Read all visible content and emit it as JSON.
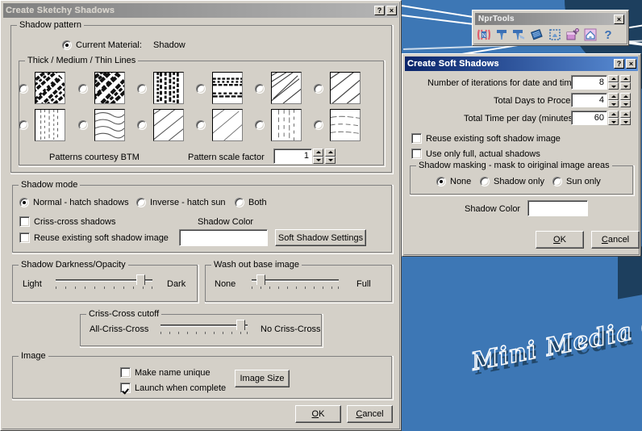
{
  "desktop": {
    "wallpaper_text": "Mini Media C",
    "bg_color": "#3d77b5",
    "accent_dark": "#1d3f5e"
  },
  "sketchy_dialog": {
    "title": "Create Sketchy Shadows",
    "title_state": "inactive",
    "help_button": "?",
    "close_button": "×",
    "shadow_pattern": {
      "group_label": "Shadow pattern",
      "current_material_label": "Current Material:",
      "current_material_value": "Shadow",
      "current_material_selected": true,
      "lines_group_label": "Thick / Medium / Thin Lines",
      "courtesy_label": "Patterns courtesy BTM",
      "scale_factor_label": "Pattern scale factor",
      "scale_factor_value": "1",
      "patterns": [
        {
          "id": "pattern-1",
          "selected": false,
          "kind": "thick-diagonal"
        },
        {
          "id": "pattern-2",
          "selected": false,
          "kind": "thick-diagonal-coarse"
        },
        {
          "id": "pattern-3",
          "selected": false,
          "kind": "thick-vertical"
        },
        {
          "id": "pattern-4",
          "selected": false,
          "kind": "thick-horizontal"
        },
        {
          "id": "pattern-5",
          "selected": false,
          "kind": "medium-diagonal"
        },
        {
          "id": "pattern-6",
          "selected": false,
          "kind": "medium-diagonal-2"
        },
        {
          "id": "pattern-7",
          "selected": false,
          "kind": "thin-vertical"
        },
        {
          "id": "pattern-8",
          "selected": false,
          "kind": "thin-wavy"
        },
        {
          "id": "pattern-9",
          "selected": false,
          "kind": "thin-diagonal"
        },
        {
          "id": "pattern-10",
          "selected": false,
          "kind": "thin-diagonal-sparse"
        },
        {
          "id": "pattern-11",
          "selected": false,
          "kind": "thin-vertical-sparse"
        },
        {
          "id": "pattern-12",
          "selected": false,
          "kind": "thin-horizontal"
        }
      ]
    },
    "shadow_mode": {
      "group_label": "Shadow mode",
      "modes": [
        {
          "label": "Normal - hatch shadows",
          "selected": true
        },
        {
          "label": "Inverse - hatch sun",
          "selected": false
        },
        {
          "label": "Both",
          "selected": false
        }
      ],
      "criss_cross_label": "Criss-cross shadows",
      "criss_cross_checked": false,
      "reuse_label": "Reuse existing soft shadow image",
      "reuse_checked": false,
      "shadow_color_label": "Shadow Color",
      "shadow_color_value": "#ffffff",
      "soft_shadow_settings_button": "Soft Shadow Settings"
    },
    "darkness": {
      "group_label": "Shadow Darkness/Opacity",
      "min_label": "Light",
      "max_label": "Dark",
      "value_pct": 88,
      "ticks": 11
    },
    "washout": {
      "group_label": "Wash out base image",
      "min_label": "None",
      "max_label": "Full",
      "value_pct": 6,
      "ticks": 11
    },
    "crisscross_cutoff": {
      "group_label": "Criss-Cross cutoff",
      "min_label": "All-Criss-Cross",
      "max_label": "No Criss-Cross",
      "value_pct": 92,
      "ticks": 11
    },
    "image": {
      "group_label": "Image",
      "make_unique_label": "Make name unique",
      "make_unique_checked": false,
      "launch_label": "Launch when complete",
      "launch_checked": true,
      "image_size_button": "Image Size"
    },
    "ok_button": "OK",
    "cancel_button": "Cancel"
  },
  "soft_dialog": {
    "title": "Create Soft Shadows",
    "title_state": "active",
    "help_button": "?",
    "close_button": "×",
    "fields": [
      {
        "label": "Number of iterations for date and time",
        "value": "8"
      },
      {
        "label": "Total Days to Process",
        "value": "4"
      },
      {
        "label": "Total Time per day (minutes)",
        "value": "60"
      }
    ],
    "reuse_label": "Reuse existing soft shadow image",
    "reuse_checked": false,
    "use_full_label": "Use only full, actual shadows",
    "use_full_checked": false,
    "masking": {
      "group_label": "Shadow masking - mask to oiriginal image areas",
      "options": [
        {
          "label": "None",
          "selected": true
        },
        {
          "label": "Shadow only",
          "selected": false
        },
        {
          "label": "Sun only",
          "selected": false
        }
      ]
    },
    "shadow_color_label": "Shadow Color",
    "shadow_color_value": "#ffffff",
    "ok_button": "OK",
    "cancel_button": "Cancel"
  },
  "nprtools": {
    "title": "NprTools",
    "close_button": "×",
    "tools": [
      {
        "name": "npr-logo-icon"
      },
      {
        "name": "tack-icon"
      },
      {
        "name": "tack-shadow-icon"
      },
      {
        "name": "layers-icon"
      },
      {
        "name": "selection-icon"
      },
      {
        "name": "paint-bucket-icon"
      },
      {
        "name": "house-icon"
      },
      {
        "name": "help-icon"
      }
    ]
  }
}
